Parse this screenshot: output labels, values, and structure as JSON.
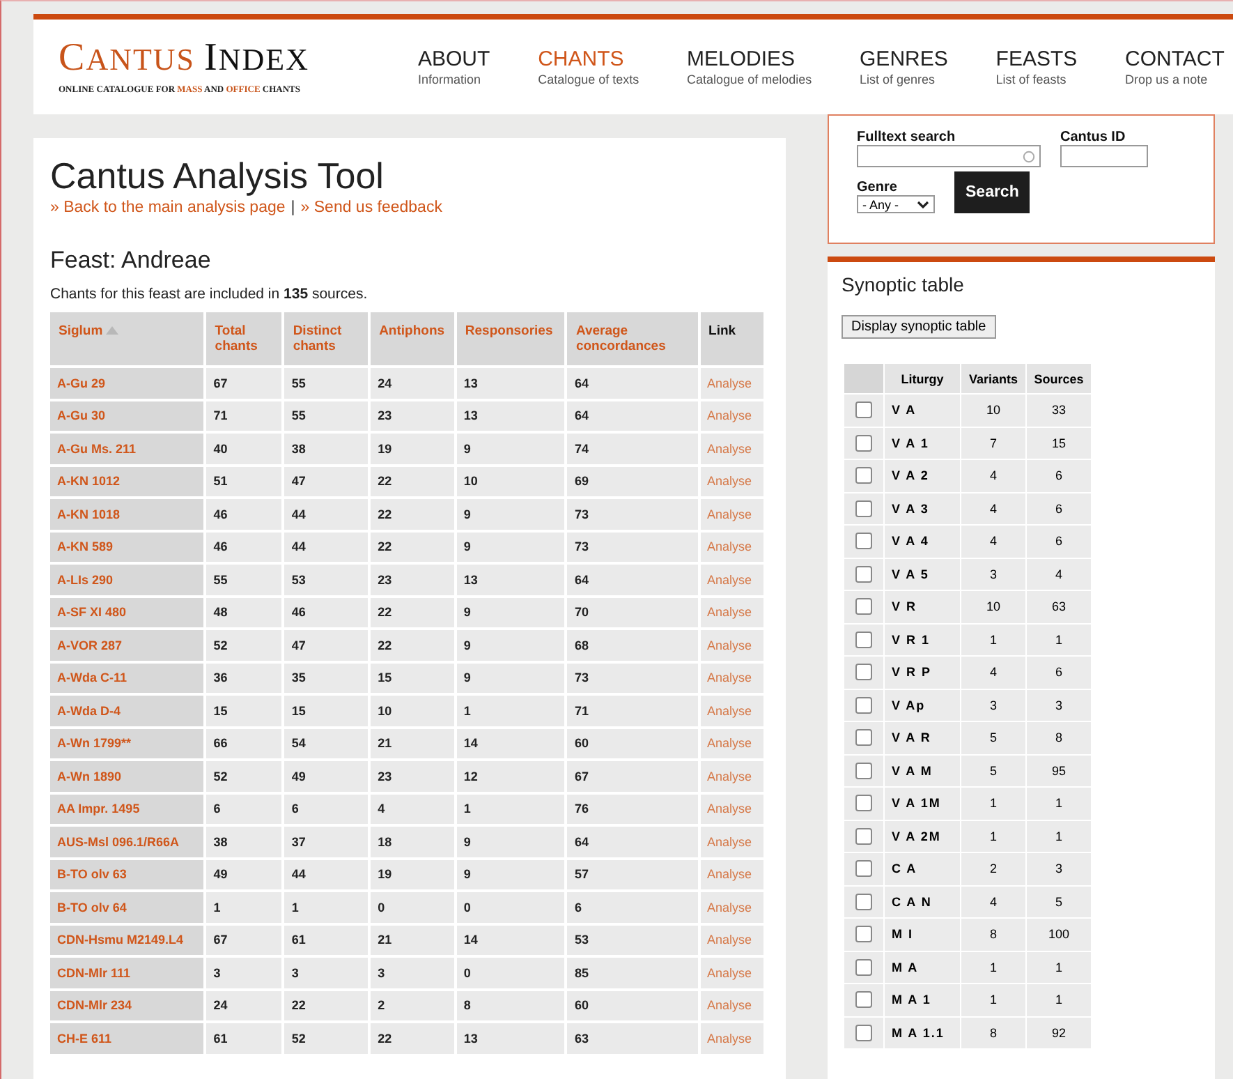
{
  "logo": {
    "title_parts": [
      {
        "text": "C",
        "large": true
      },
      {
        "text": "ANTUS ",
        "large": false
      },
      {
        "text": "I",
        "large": true
      },
      {
        "text": "NDEX",
        "large": false
      }
    ],
    "subtitle_parts": [
      {
        "text": "ONLINE CATALOGUE FOR ",
        "accent": false
      },
      {
        "text": "MASS",
        "accent": true
      },
      {
        "text": " AND ",
        "accent": false
      },
      {
        "text": "OFFICE",
        "accent": true
      },
      {
        "text": " CHANTS",
        "accent": false
      }
    ]
  },
  "nav": [
    {
      "label": "ABOUT",
      "sub": "Information",
      "selected": false
    },
    {
      "label": "CHANTS",
      "sub": "Catalogue of texts",
      "selected": true
    },
    {
      "label": "MELODIES",
      "sub": "Catalogue of melodies",
      "selected": false
    },
    {
      "label": "GENRES",
      "sub": "List of genres",
      "selected": false
    },
    {
      "label": "FEASTS",
      "sub": "List of feasts",
      "selected": false
    },
    {
      "label": "CONTACT",
      "sub": "Drop us a note",
      "selected": false
    }
  ],
  "main": {
    "title": "Cantus Analysis Tool",
    "links": [
      "» Back to the main analysis page",
      "» Send us feedback"
    ],
    "separator": "|",
    "feast": "Feast: Andreae",
    "summary": "Chants for this feast are included in **135** sources.",
    "columns": [
      {
        "label": "Siglum",
        "sortable": true,
        "sorted": true
      },
      {
        "label": "Total chants",
        "sortable": true,
        "sorted": false
      },
      {
        "label": "Distinct chants",
        "sortable": true,
        "sorted": false
      },
      {
        "label": "Antiphons",
        "sortable": true,
        "sorted": false
      },
      {
        "label": "Responsories",
        "sortable": true,
        "sorted": false
      },
      {
        "label": "Average concordances",
        "sortable": true,
        "sorted": false
      },
      {
        "label": "Link",
        "sortable": false,
        "sorted": false
      }
    ],
    "rows": [
      [
        "A-Gu 29",
        "67",
        "55",
        "24",
        "13",
        "64",
        "Analyse"
      ],
      [
        "A-Gu 30",
        "71",
        "55",
        "23",
        "13",
        "64",
        "Analyse"
      ],
      [
        "A-Gu Ms. 211",
        "40",
        "38",
        "19",
        "9",
        "74",
        "Analyse"
      ],
      [
        "A-KN 1012",
        "51",
        "47",
        "22",
        "10",
        "69",
        "Analyse"
      ],
      [
        "A-KN 1018",
        "46",
        "44",
        "22",
        "9",
        "73",
        "Analyse"
      ],
      [
        "A-KN 589",
        "46",
        "44",
        "22",
        "9",
        "73",
        "Analyse"
      ],
      [
        "A-LIs 290",
        "55",
        "53",
        "23",
        "13",
        "64",
        "Analyse"
      ],
      [
        "A-SF XI 480",
        "48",
        "46",
        "22",
        "9",
        "70",
        "Analyse"
      ],
      [
        "A-VOR 287",
        "52",
        "47",
        "22",
        "9",
        "68",
        "Analyse"
      ],
      [
        "A-Wda C-11",
        "36",
        "35",
        "15",
        "9",
        "73",
        "Analyse"
      ],
      [
        "A-Wda D-4",
        "15",
        "15",
        "10",
        "1",
        "71",
        "Analyse"
      ],
      [
        "A-Wn 1799**",
        "66",
        "54",
        "21",
        "14",
        "60",
        "Analyse"
      ],
      [
        "A-Wn 1890",
        "52",
        "49",
        "23",
        "12",
        "67",
        "Analyse"
      ],
      [
        "AA Impr. 1495",
        "6",
        "6",
        "4",
        "1",
        "76",
        "Analyse"
      ],
      [
        "AUS-Msl 096.1/R66A",
        "38",
        "37",
        "18",
        "9",
        "64",
        "Analyse"
      ],
      [
        "B-TO olv 63",
        "49",
        "44",
        "19",
        "9",
        "57",
        "Analyse"
      ],
      [
        "B-TO olv 64",
        "1",
        "1",
        "0",
        "0",
        "6",
        "Analyse"
      ],
      [
        "CDN-Hsmu M2149.L4",
        "67",
        "61",
        "21",
        "14",
        "53",
        "Analyse"
      ],
      [
        "CDN-Mlr 111",
        "3",
        "3",
        "3",
        "0",
        "85",
        "Analyse"
      ],
      [
        "CDN-Mlr 234",
        "24",
        "22",
        "2",
        "8",
        "60",
        "Analyse"
      ],
      [
        "CH-E 611",
        "61",
        "52",
        "22",
        "13",
        "63",
        "Analyse"
      ]
    ]
  },
  "search": {
    "fulltext_label": "Fulltext search",
    "cantus_id_label": "Cantus ID",
    "genre_label": "Genre",
    "genre_value": "- Any -",
    "button": "Search"
  },
  "synoptic": {
    "title": "Synoptic table",
    "button": "Display synoptic table",
    "columns": [
      "Liturgy",
      "Variants",
      "Sources"
    ],
    "rows": [
      {
        "liturgy": "V A",
        "variants": "10",
        "sources": "33",
        "checked": false
      },
      {
        "liturgy": "V A 1",
        "variants": "7",
        "sources": "15",
        "checked": false
      },
      {
        "liturgy": "V A 2",
        "variants": "4",
        "sources": "6",
        "checked": false
      },
      {
        "liturgy": "V A 3",
        "variants": "4",
        "sources": "6",
        "checked": false
      },
      {
        "liturgy": "V A 4",
        "variants": "4",
        "sources": "6",
        "checked": false
      },
      {
        "liturgy": "V A 5",
        "variants": "3",
        "sources": "4",
        "checked": false
      },
      {
        "liturgy": "V R",
        "variants": "10",
        "sources": "63",
        "checked": false
      },
      {
        "liturgy": "V R 1",
        "variants": "1",
        "sources": "1",
        "checked": false
      },
      {
        "liturgy": "V R P",
        "variants": "4",
        "sources": "6",
        "checked": false
      },
      {
        "liturgy": "V Ap",
        "variants": "3",
        "sources": "3",
        "checked": false
      },
      {
        "liturgy": "V A R",
        "variants": "5",
        "sources": "8",
        "checked": false
      },
      {
        "liturgy": "V A M",
        "variants": "5",
        "sources": "95",
        "checked": false
      },
      {
        "liturgy": "V A 1M",
        "variants": "1",
        "sources": "1",
        "checked": false
      },
      {
        "liturgy": "V A 2M",
        "variants": "1",
        "sources": "1",
        "checked": false
      },
      {
        "liturgy": "C A",
        "variants": "2",
        "sources": "3",
        "checked": false
      },
      {
        "liturgy": "C A N",
        "variants": "4",
        "sources": "5",
        "checked": false
      },
      {
        "liturgy": "M I",
        "variants": "8",
        "sources": "100",
        "checked": false
      },
      {
        "liturgy": "M A",
        "variants": "1",
        "sources": "1",
        "checked": false
      },
      {
        "liturgy": "M A 1",
        "variants": "1",
        "sources": "1",
        "checked": false
      },
      {
        "liturgy": "M A 1.1",
        "variants": "8",
        "sources": "92",
        "checked": false
      }
    ]
  }
}
